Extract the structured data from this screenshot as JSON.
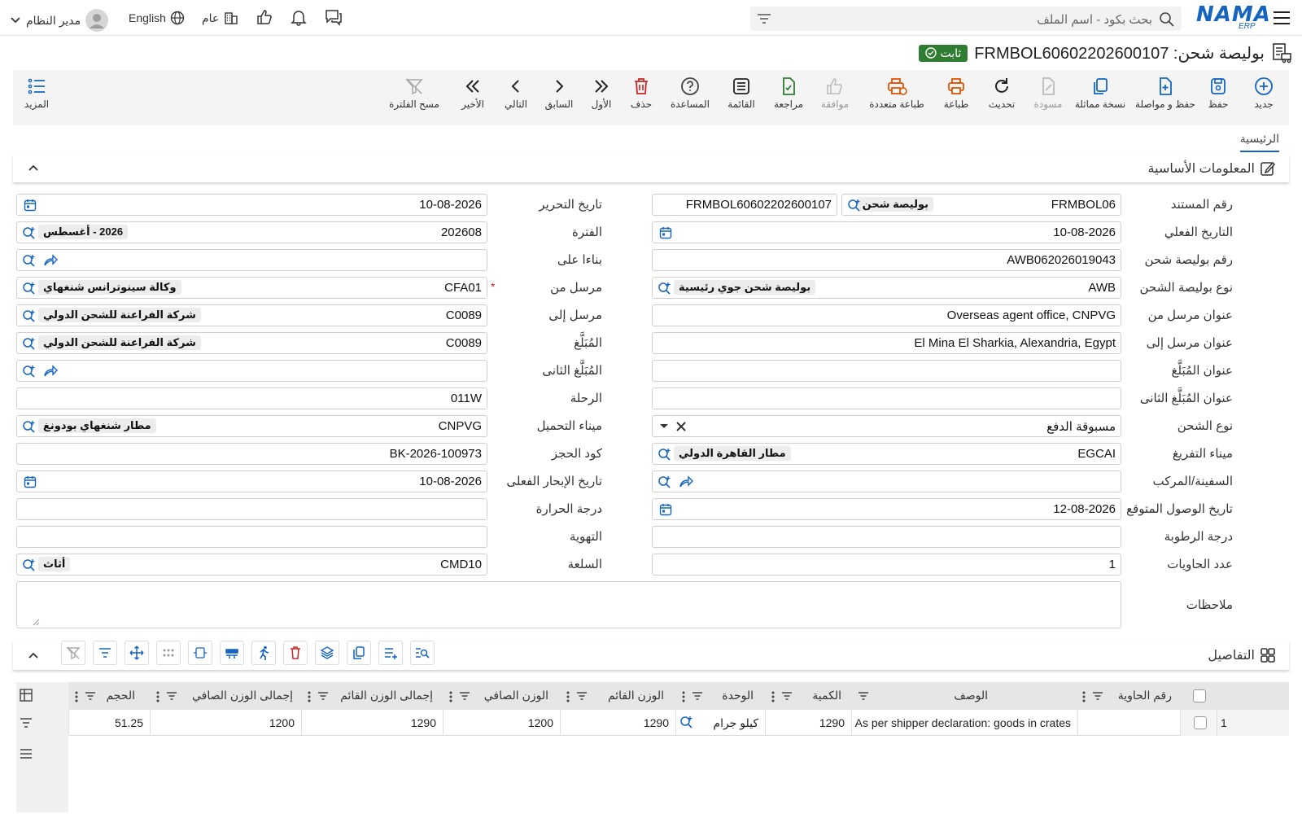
{
  "topbar": {
    "search_placeholder": "بحث بكود - اسم الملف",
    "logo": "NAMA",
    "logo_sub": "ERP",
    "user": "مدير النظام",
    "language": "English",
    "branch": "عام"
  },
  "title": {
    "text": "بوليصة شحن: FRMBOL60602202600107",
    "status": "ثابت"
  },
  "toolbar": {
    "new": "جديد",
    "save": "حفظ",
    "save_continue": "حفظ و مواصلة",
    "duplicate": "نسخة مماثلة",
    "draft": "مسودة",
    "refresh": "تحديث",
    "print": "طباعة",
    "multi_print": "طباعة متعددة",
    "approve": "موافقة",
    "review": "مراجعة",
    "list": "القائمة",
    "help": "المساعدة",
    "delete": "حذف",
    "first": "الأول",
    "previous": "السابق",
    "next": "التالي",
    "last": "الأخير",
    "clear_filter": "مسح الفلترة",
    "more": "المزيد"
  },
  "tabs": {
    "main": "الرئيسية"
  },
  "basic": {
    "title": "المعلومات الأساسية",
    "labels": {
      "doc_no": "رقم المستند",
      "actual_date": "التاريخ الفعلي",
      "bol_no": "رقم بوليصة شحن",
      "bol_type": "نوع بوليصة الشحن",
      "sender_address": "عنوان مرسل من",
      "receiver_address": "عنوان مرسل إلى",
      "notify_address": "عنوان المُبَلَّغ",
      "notify2_address": "عنوان المُبَلَّغ الثانى",
      "shipment_type": "نوع الشحن",
      "discharge_port": "ميناء التفريغ",
      "vessel": "السفينة/المركب",
      "eta": "تاريخ الوصول المتوقع",
      "humidity": "درجة الرطوبة",
      "containers": "عدد الحاويات",
      "notes": "ملاحظات",
      "issue_date": "تاريخ التحرير",
      "period": "الفترة",
      "based_on": "بناءا على",
      "sender": "مرسل من",
      "receiver": "مرسل إلى",
      "notify": "المُبَلَّغ",
      "notify2": "المُبَلَّغ الثانى",
      "voyage": "الرحلة",
      "loading_port": "ميناء التحميل",
      "booking_code": "كود الحجز",
      "actual_sailing": "تاريخ الإبحار الفعلى",
      "temperature": "درجة الحرارة",
      "ventilation": "التهوية",
      "commodity": "السلعة"
    },
    "values": {
      "doc_code": "FRMBOL06",
      "doc_type": "بوليصة شحن",
      "doc_number": "FRMBOL60602202600107",
      "actual_date": "10-08-2026",
      "bol_no": "AWB062026019043",
      "bol_type_code": "AWB",
      "bol_type_name": "بوليصة شحن جوي رئيسية",
      "sender_address": "Overseas agent office, CNPVG",
      "receiver_address": "El Mina El Sharkia, Alexandria, Egypt",
      "shipment_type": "مسبوقة الدفع",
      "discharge_code": "EGCAI",
      "discharge_name": "مطار القاهرة الدولي",
      "eta": "12-08-2026",
      "containers": "1",
      "issue_date": "10-08-2026",
      "period_code": "202608",
      "period_name": "2026 - أغسطس",
      "sender_code": "CFA01",
      "sender_name": "وكالة سينوترانس شنغهاي",
      "receiver_code": "C0089",
      "receiver_name": "شركة الفراعنة للشحن الدولي",
      "notify_code": "C0089",
      "notify_name": "شركة الفراعنة للشحن الدولي",
      "voyage": "011W",
      "loading_code": "CNPVG",
      "loading_name": "مطار شنغهاي بودونغ",
      "booking_code": "BK-2026-100973",
      "actual_sailing": "10-08-2026",
      "commodity_code": "CMD10",
      "commodity_name": "أثاث"
    }
  },
  "details": {
    "title": "التفاصيل",
    "columns": [
      "رقم الحاوية",
      "الوصف",
      "الكمية",
      "الوحدة",
      "الوزن القائم",
      "الوزن الصافي",
      "إجمالى الوزن القائم",
      "إجمالى الوزن الصافي",
      "الحجم"
    ],
    "rows": [
      {
        "index": "1",
        "container": "",
        "description": "As per shipper declaration: goods in crates",
        "quantity": "1290",
        "unit": "كيلو جرام",
        "gross_weight": "1290",
        "net_weight": "1200",
        "total_gross": "1290",
        "total_net": "1200",
        "volume": "51.25"
      }
    ]
  },
  "colors": {
    "accent": "#1565c0",
    "status_green": "#2e7d32",
    "danger": "#c62828",
    "print_orange": "#e65100"
  }
}
